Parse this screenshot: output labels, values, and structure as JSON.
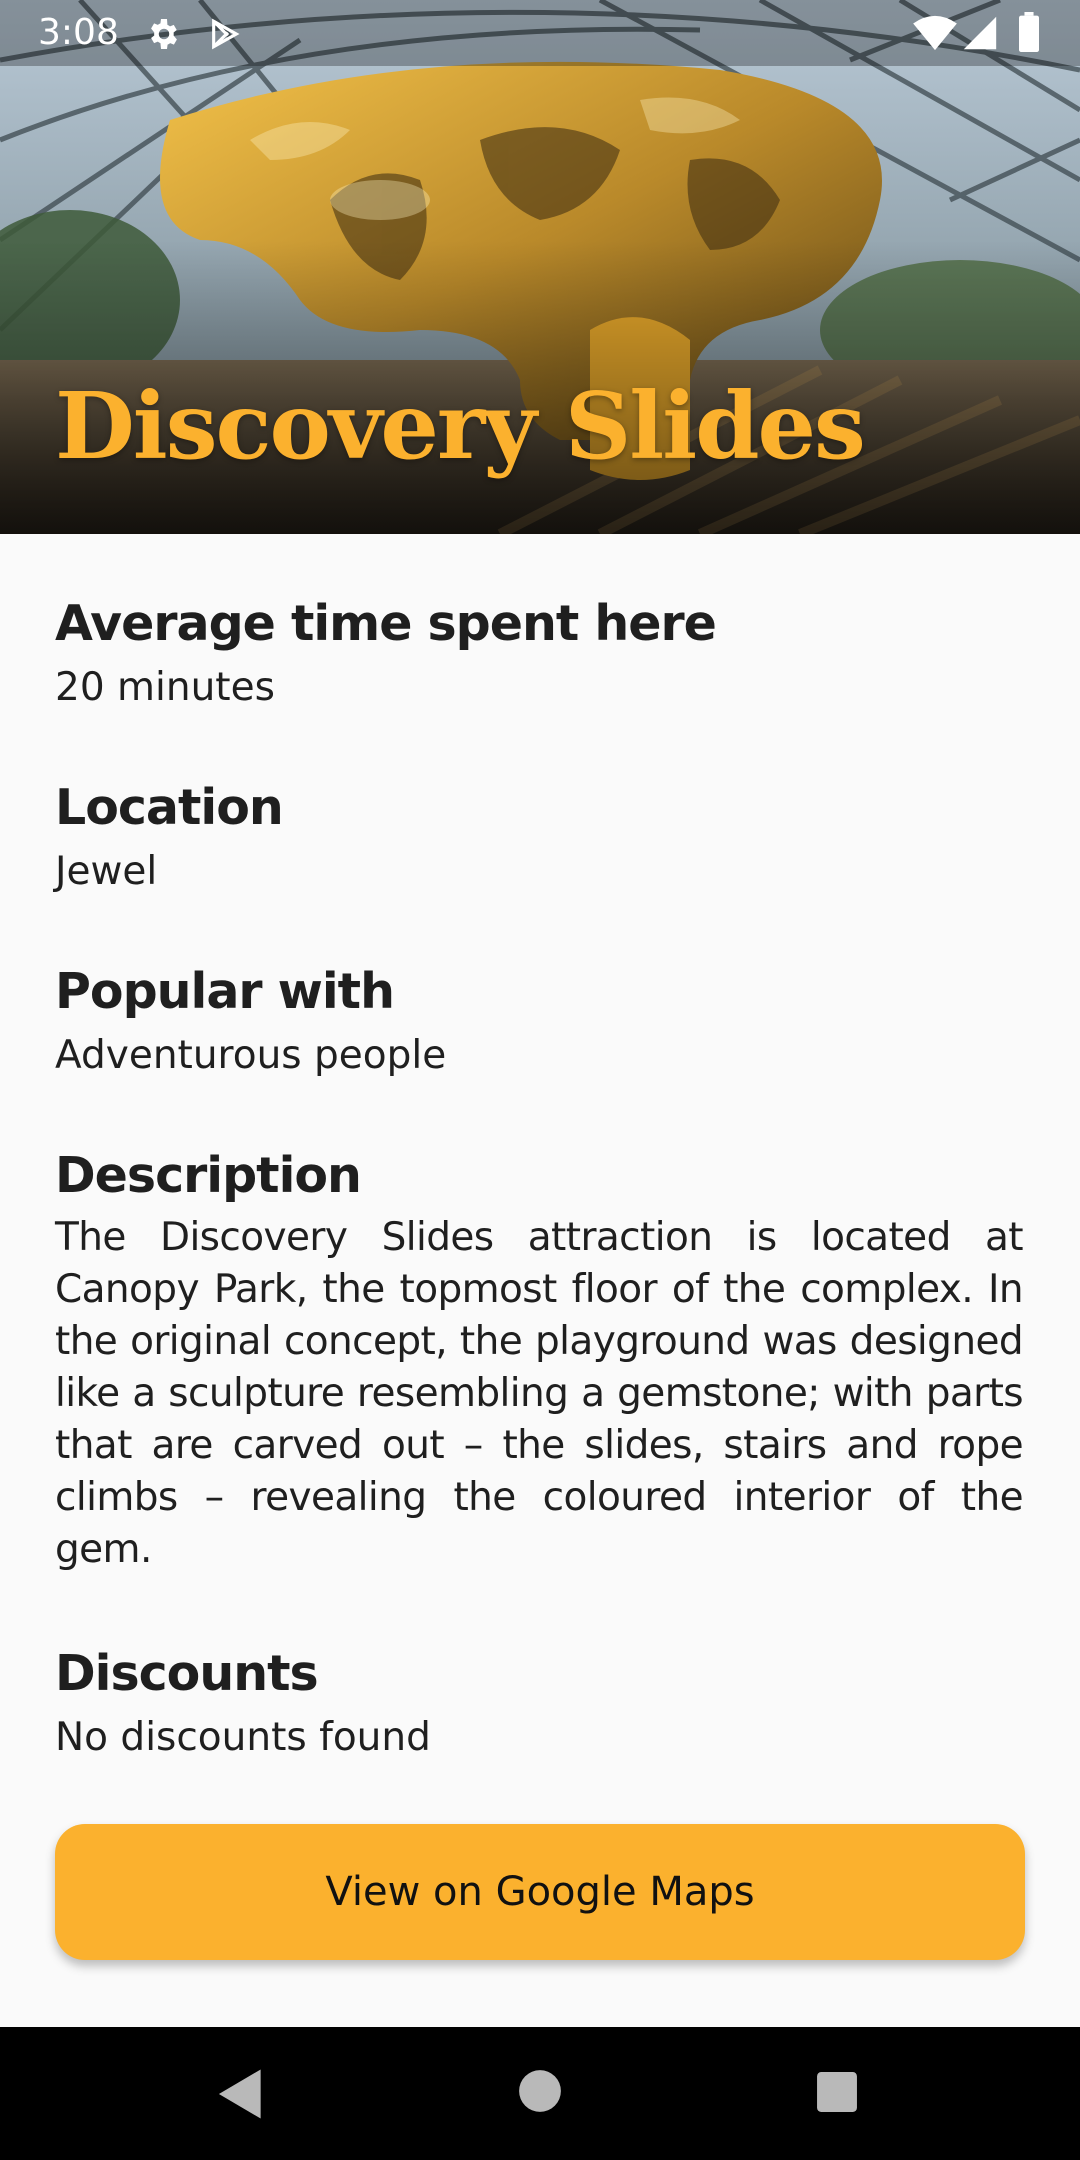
{
  "status_bar": {
    "time": "3:08",
    "icons": [
      "settings-icon",
      "play-store-icon",
      "wifi-icon",
      "signal-icon",
      "battery-icon"
    ]
  },
  "hero": {
    "title": "Discovery Slides",
    "image": "photo-of-jewel-canopy-park-discovery-slides"
  },
  "sections": {
    "time": {
      "heading": "Average time spent here",
      "value": "20 minutes"
    },
    "location": {
      "heading": "Location",
      "value": "Jewel"
    },
    "popular": {
      "heading": "Popular with",
      "value": "Adventurous people"
    },
    "description": {
      "heading": "Description",
      "value": "The Discovery Slides attraction is located at Canopy Park, the topmost floor of the complex. In the original concept, the playground was designed like a sculpture resembling a gemstone; with parts that are carved out – the slides, stairs and rope climbs – revealing the coloured interior of the gem."
    },
    "discounts": {
      "heading": "Discounts",
      "value": "No discounts found"
    }
  },
  "button": {
    "label": "View on Google Maps"
  },
  "nav": {
    "icons": [
      "back-icon",
      "home-icon",
      "recents-icon"
    ]
  },
  "colors": {
    "accent": "#fbb12e",
    "background": "#fafafa",
    "text": "#1f1f1f",
    "nav": "#000000"
  }
}
